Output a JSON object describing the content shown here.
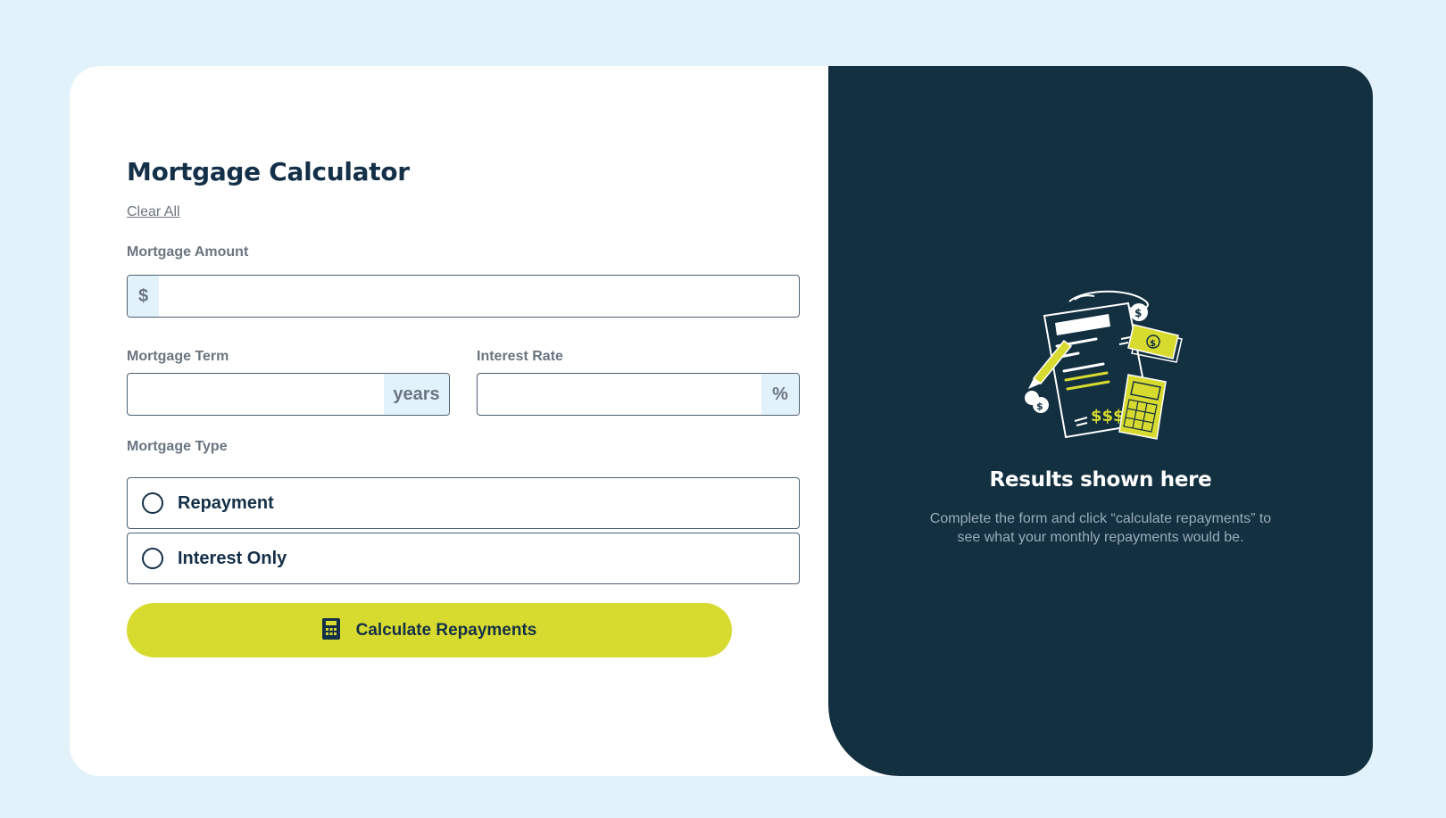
{
  "form": {
    "title": "Mortgage Calculator",
    "clear_all": "Clear All",
    "amount": {
      "label": "Mortgage Amount",
      "prefix": "$",
      "value": ""
    },
    "term": {
      "label": "Mortgage Term",
      "suffix": "years",
      "value": ""
    },
    "rate": {
      "label": "Interest Rate",
      "suffix": "%",
      "value": ""
    },
    "type": {
      "label": "Mortgage Type",
      "options": [
        {
          "label": "Repayment",
          "selected": false
        },
        {
          "label": "Interest Only",
          "selected": false
        }
      ]
    },
    "submit_label": "Calculate Repayments"
  },
  "results": {
    "title": "Results shown here",
    "description": "Complete the form and click “calculate repayments” to see what your monthly repayments would be."
  },
  "colors": {
    "background": "#e2f2fb",
    "panel_dark": "#133041",
    "accent_lime": "#d8db2f",
    "text_dark": "#143048",
    "text_muted": "#6b7580"
  },
  "icons": {
    "button_icon": "calculator-icon",
    "illustration": "empty-results-illustration"
  }
}
